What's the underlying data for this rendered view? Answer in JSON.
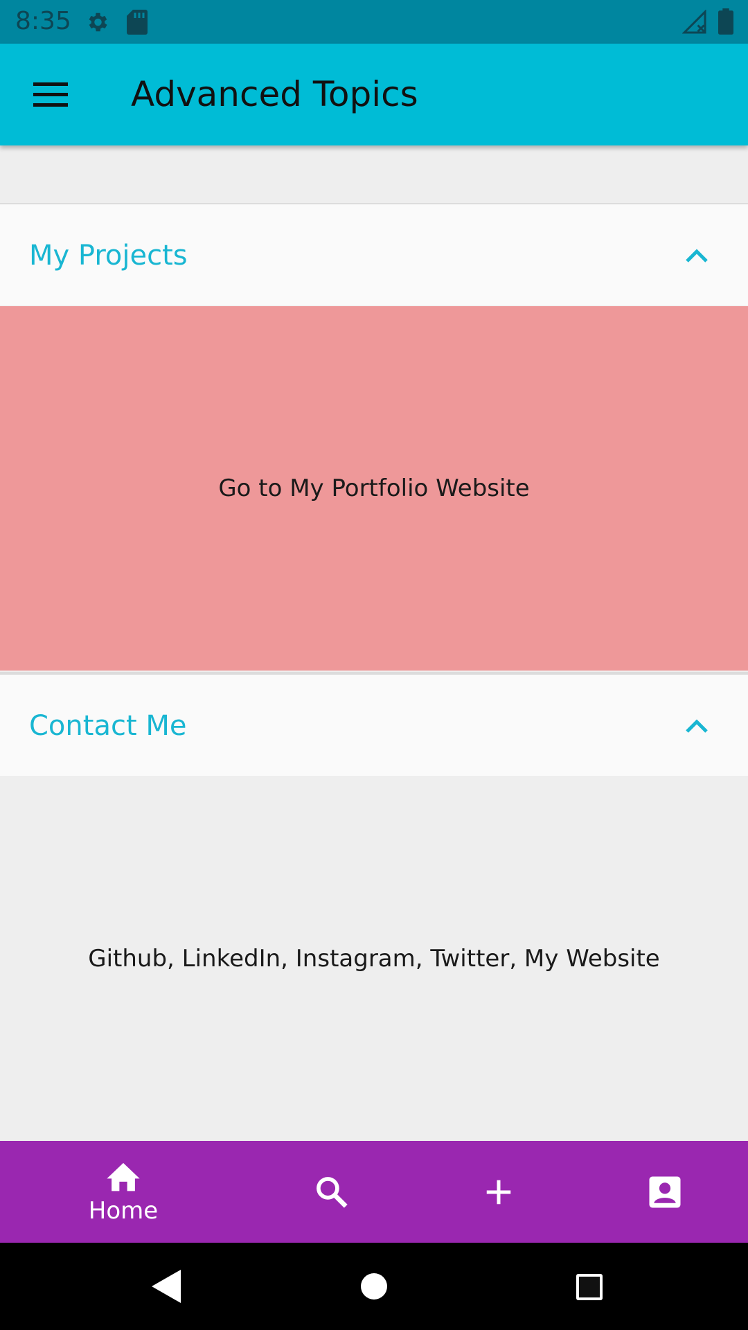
{
  "status_bar": {
    "time": "8:35",
    "icons": [
      "gear-icon",
      "sd-card-icon",
      "signal-icon",
      "battery-icon"
    ]
  },
  "app_bar": {
    "title": "Advanced Topics",
    "menu_icon": "menu-icon",
    "color": "#00bcd6"
  },
  "sections": [
    {
      "title": "My Projects",
      "expanded": true,
      "content": "Go to My Portfolio Website",
      "content_bg": "#ee9899"
    },
    {
      "title": "Contact Me",
      "expanded": true,
      "content": "Github, LinkedIn, Instagram, Twitter, My Website",
      "content_bg": "#eeeeee"
    }
  ],
  "bottom_nav": {
    "color": "#9a27b0",
    "items": [
      {
        "icon": "home-icon",
        "label": "Home",
        "active": true
      },
      {
        "icon": "search-icon",
        "label": ""
      },
      {
        "icon": "add-icon",
        "label": ""
      },
      {
        "icon": "account-icon",
        "label": ""
      }
    ]
  },
  "system_nav": {
    "icons": [
      "back-icon",
      "home-circle-icon",
      "recents-icon"
    ]
  }
}
